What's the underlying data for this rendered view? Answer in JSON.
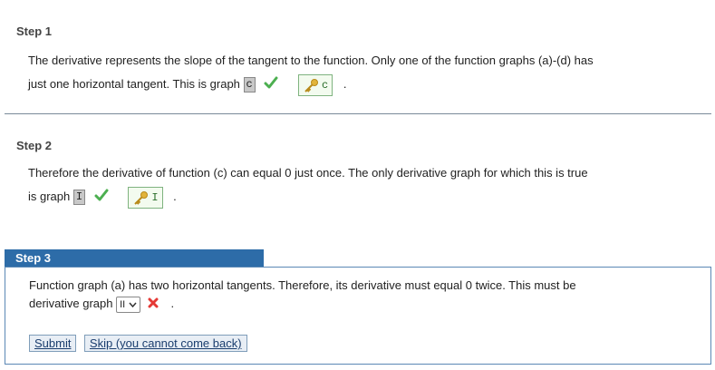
{
  "step1": {
    "title": "Step 1",
    "line1": "The derivative represents the slope of the tangent to the function. Only one of the function graphs (a)-(d) has",
    "line2_prefix": "just one horizontal tangent. This is graph",
    "answer": "c",
    "key_answer": "c",
    "suffix": "."
  },
  "step2": {
    "title": "Step 2",
    "line1": "Therefore the derivative of function (c) can equal 0 just once. The only derivative graph for which this is true",
    "line2_prefix": "is graph",
    "answer": "I",
    "key_answer": "I",
    "suffix": "."
  },
  "step3": {
    "title": "Step 3",
    "line1": "Function graph (a) has two horizontal tangents. Therefore, its derivative must equal 0 twice. This must be",
    "line2_prefix": "derivative graph",
    "select_value": "II",
    "suffix": ".",
    "submit_label": "Submit",
    "skip_label": "Skip (you cannot come back)"
  },
  "colors": {
    "correct": "#4caf50",
    "incorrect": "#e53935",
    "accent": "#2d6ca8"
  }
}
